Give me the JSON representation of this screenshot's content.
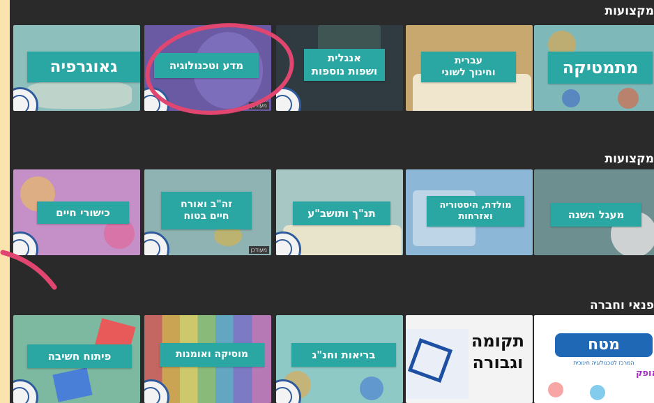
{
  "sections": [
    {
      "title": "מקצועות"
    },
    {
      "title": "מקצועות"
    },
    {
      "title": "פנאי וחברה"
    }
  ],
  "row1": [
    {
      "label": "מתמטיקה",
      "bg": "#7fb8b9"
    },
    {
      "label_line1": "עברית",
      "label_line2": "וחינוך לשוני",
      "bg": "#c9a870"
    },
    {
      "label_line1": "אנגלית",
      "label_line2": "ושפות נוספות",
      "bg": "#2f3b40"
    },
    {
      "label": "מדע וטכנולוגיה",
      "tag": "מעודכן",
      "bg": "#6a5aa3"
    },
    {
      "label": "גאוגרפיה",
      "bg": "#8dc0bd"
    }
  ],
  "row2": [
    {
      "label": "מעגל השנה",
      "bg": "#6e8f90"
    },
    {
      "label_line1": "מולדת, היסטוריה",
      "label_line2": "ואזרחות",
      "bg": "#8cb7d6"
    },
    {
      "label": "תנ\"ך ותושב\"ע",
      "bg": "#a7c7c4"
    },
    {
      "label_line1": "זה\"ב ואורח",
      "label_line2": "חיים בטוח",
      "tag": "מעודכן",
      "bg": "#8fb3b2"
    },
    {
      "label": "כישורי חיים",
      "bg": "#c58fc7"
    }
  ],
  "row3": [
    {
      "logo_text": "מטח",
      "subtitle": "המרכז לטכנולוגיה חינוכית",
      "footer_text": "אופק",
      "bg": "#ffffff"
    },
    {
      "label_line1": "תקומה",
      "label_line2": "וגבורה",
      "bg": "#f3f3f3"
    },
    {
      "label": "בריאות וחנ\"ג",
      "bg": "#8ec9c6"
    },
    {
      "label": "מוסיקה ואומנות",
      "bg": "#2f2f2f"
    },
    {
      "label": "פיתוח חשיבה",
      "bg": "#7db8a0"
    }
  ],
  "colors": {
    "frame": "#fbe3ad",
    "screen": "#2a2a2a",
    "banner": "#2aa6a3",
    "annotation": "#e0466f"
  }
}
